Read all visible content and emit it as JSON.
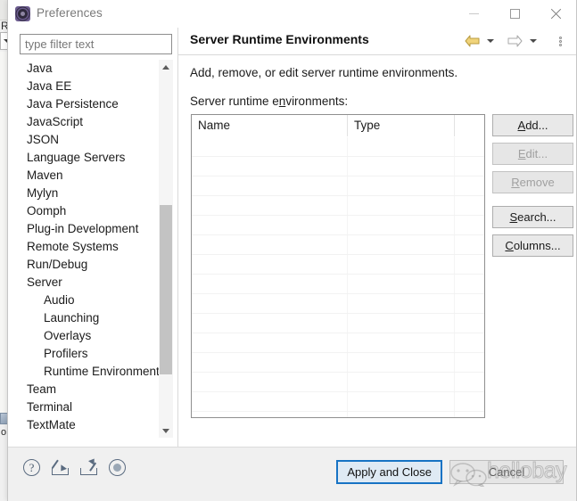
{
  "background_window": {
    "label_r": "R",
    "label_o": "o"
  },
  "window": {
    "title": "Preferences",
    "icon": "preferences-gear-icon",
    "controls": {
      "minimize": "minimize-icon",
      "maximize": "maximize-icon",
      "close": "close-icon"
    }
  },
  "filter": {
    "placeholder": "type filter text",
    "value": ""
  },
  "tree": {
    "items": [
      {
        "label": "Java",
        "level": 1,
        "selected": false
      },
      {
        "label": "Java EE",
        "level": 1,
        "selected": false
      },
      {
        "label": "Java Persistence",
        "level": 1,
        "selected": false
      },
      {
        "label": "JavaScript",
        "level": 1,
        "selected": false
      },
      {
        "label": "JSON",
        "level": 1,
        "selected": false
      },
      {
        "label": "Language Servers",
        "level": 1,
        "selected": false
      },
      {
        "label": "Maven",
        "level": 1,
        "selected": false
      },
      {
        "label": "Mylyn",
        "level": 1,
        "selected": false
      },
      {
        "label": "Oomph",
        "level": 1,
        "selected": false
      },
      {
        "label": "Plug-in Development",
        "level": 1,
        "selected": false
      },
      {
        "label": "Remote Systems",
        "level": 1,
        "selected": false
      },
      {
        "label": "Run/Debug",
        "level": 1,
        "selected": false
      },
      {
        "label": "Server",
        "level": 1,
        "selected": false
      },
      {
        "label": "Audio",
        "level": 2,
        "selected": false
      },
      {
        "label": "Launching",
        "level": 2,
        "selected": false
      },
      {
        "label": "Overlays",
        "level": 2,
        "selected": false
      },
      {
        "label": "Profilers",
        "level": 2,
        "selected": false
      },
      {
        "label": "Runtime Environments",
        "level": 2,
        "selected": true
      },
      {
        "label": "Team",
        "level": 1,
        "selected": false
      },
      {
        "label": "Terminal",
        "level": 1,
        "selected": false
      },
      {
        "label": "TextMate",
        "level": 1,
        "selected": false
      }
    ]
  },
  "detail": {
    "title": "Server Runtime Environments",
    "description": "Add, remove, or edit server runtime environments.",
    "table_label_before": "Server runtime e",
    "table_label_mnemonic": "n",
    "table_label_after": "vironments:",
    "nav": {
      "back": "back-arrow-icon",
      "back_dropdown": "back-dropdown-icon",
      "forward": "forward-arrow-icon",
      "forward_dropdown": "forward-dropdown-icon",
      "more": "view-menu-icon",
      "back_color": "#f0d37a",
      "forward_color": "#ffffff"
    },
    "table": {
      "columns": [
        "Name",
        "Type",
        ""
      ],
      "rows": [],
      "empty_row_count": 15
    },
    "buttons": [
      {
        "label_before": "",
        "mnemonic": "A",
        "label_after": "dd...",
        "enabled": true,
        "name": "add-button"
      },
      {
        "label_before": "",
        "mnemonic": "E",
        "label_after": "dit...",
        "enabled": false,
        "name": "edit-button"
      },
      {
        "label_before": "",
        "mnemonic": "R",
        "label_after": "emove",
        "enabled": false,
        "name": "remove-button"
      },
      {
        "label_before": "",
        "mnemonic": "S",
        "label_after": "earch...",
        "enabled": true,
        "name": "search-button"
      },
      {
        "label_before": "",
        "mnemonic": "C",
        "label_after": "olumns...",
        "enabled": true,
        "name": "columns-button"
      }
    ]
  },
  "footer": {
    "icons": [
      {
        "name": "help-icon"
      },
      {
        "name": "import-icon"
      },
      {
        "name": "export-icon"
      },
      {
        "name": "record-icon"
      }
    ],
    "apply_and_close": "Apply and Close",
    "cancel": "Cancel"
  },
  "watermark": {
    "text": "hellobay",
    "logo": "wechat-logo"
  },
  "colors": {
    "accent_focus": "#1773c4",
    "selection": "#d6d6d6",
    "back_arrow": "#f0d37a",
    "title_icon": "#6b5b8e"
  }
}
